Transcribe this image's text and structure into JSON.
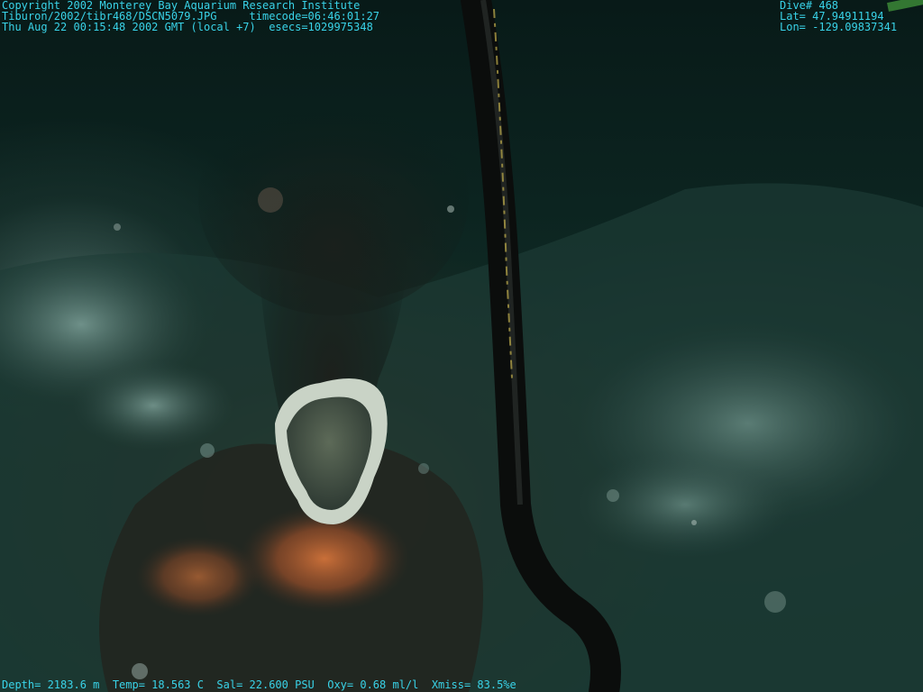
{
  "overlay": {
    "top_left": [
      "Copyright 2002 Monterey Bay Aquarium Research Institute",
      "Tiburon/2002/tibr468/DSCN5079.JPG     timecode=06:46:01:27",
      "Thu Aug 22 00:15:48 2002 GMT (local +7)  esecs=1029975348"
    ],
    "top_right": [
      "Dive# 468",
      "Lat= 47.94911194",
      "Lon= -129.09837341"
    ],
    "bottom": "Depth= 2183.6 m  Temp= 18.563 C  Sal= 22.600 PSU  Oxy= 0.68 ml/l  Xmiss= 83.5%e"
  },
  "colors": {
    "overlay_text": "#39d3e8",
    "water": "#0c2420",
    "sediment": "#2f4b45",
    "bacterial_mat": "#c2622f",
    "hose": "#0b0d0c"
  }
}
